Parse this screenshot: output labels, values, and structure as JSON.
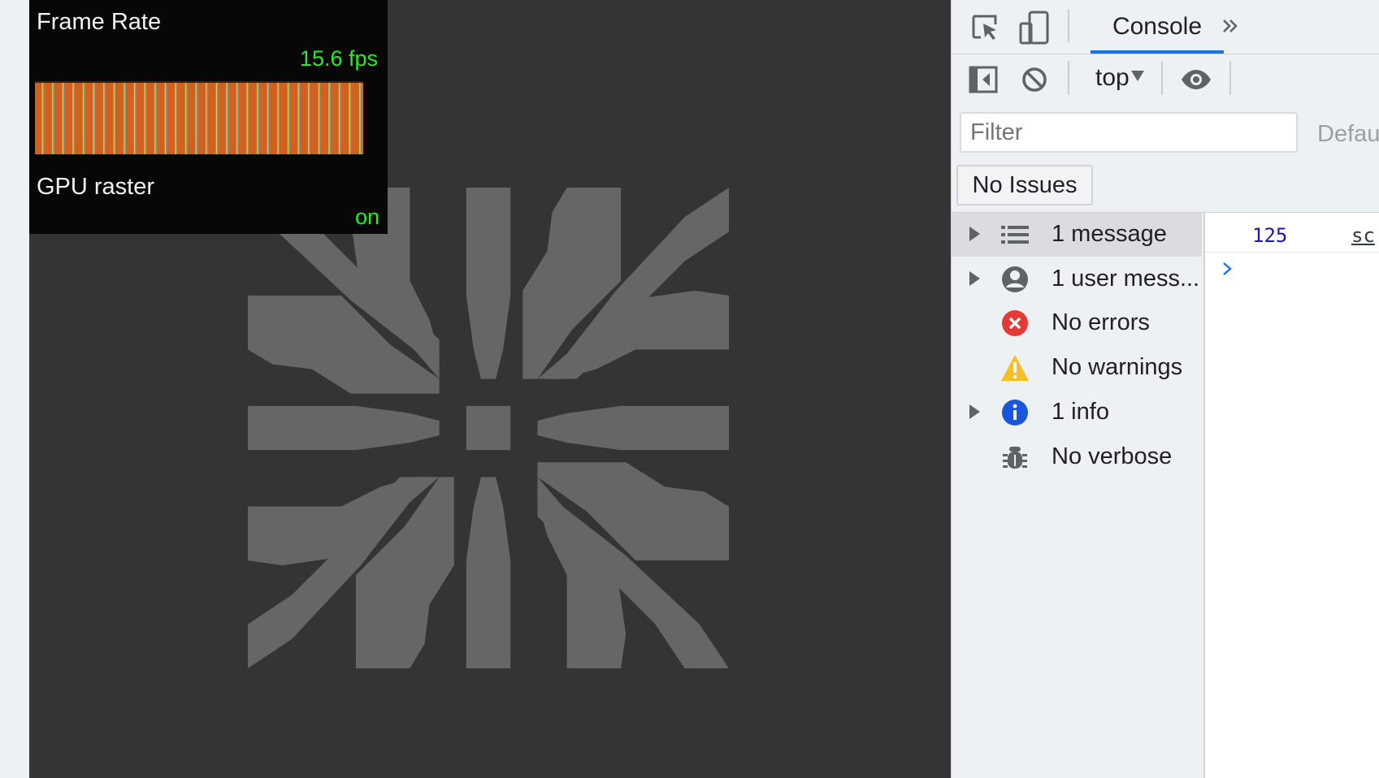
{
  "hud": {
    "frame_rate_label": "Frame Rate",
    "fps_value": "15.6 fps",
    "gpu_label": "GPU raster",
    "gpu_status": "on",
    "colors": {
      "text": "#f2f2f2",
      "value": "#26ec26",
      "bar": "#d2601f"
    }
  },
  "devtools": {
    "tabs": [
      {
        "label": "Console",
        "active": true
      }
    ],
    "more_tabs_icon": "double-chevron-right-icon",
    "context": {
      "label": "top"
    },
    "filter": {
      "placeholder": "Filter",
      "value": ""
    },
    "levels_label": "Defau",
    "issues_button": "No Issues",
    "sidebar": [
      {
        "label": "1 message",
        "icon": "list-icon",
        "expandable": true,
        "selected": true
      },
      {
        "label": "1 user mess...",
        "icon": "user-icon",
        "expandable": true,
        "selected": false
      },
      {
        "label": "No errors",
        "icon": "error-icon",
        "expandable": false,
        "selected": false
      },
      {
        "label": "No warnings",
        "icon": "warning-icon",
        "expandable": false,
        "selected": false
      },
      {
        "label": "1 info",
        "icon": "info-icon",
        "expandable": true,
        "selected": false
      },
      {
        "label": "No verbose",
        "icon": "bug-icon",
        "expandable": false,
        "selected": false
      }
    ],
    "console": {
      "message_value": "125",
      "message_source": "sc"
    },
    "colors": {
      "accent": "#1a73e8",
      "error": "#e53935",
      "warning": "#f6bf26",
      "info": "#1a56db"
    }
  }
}
